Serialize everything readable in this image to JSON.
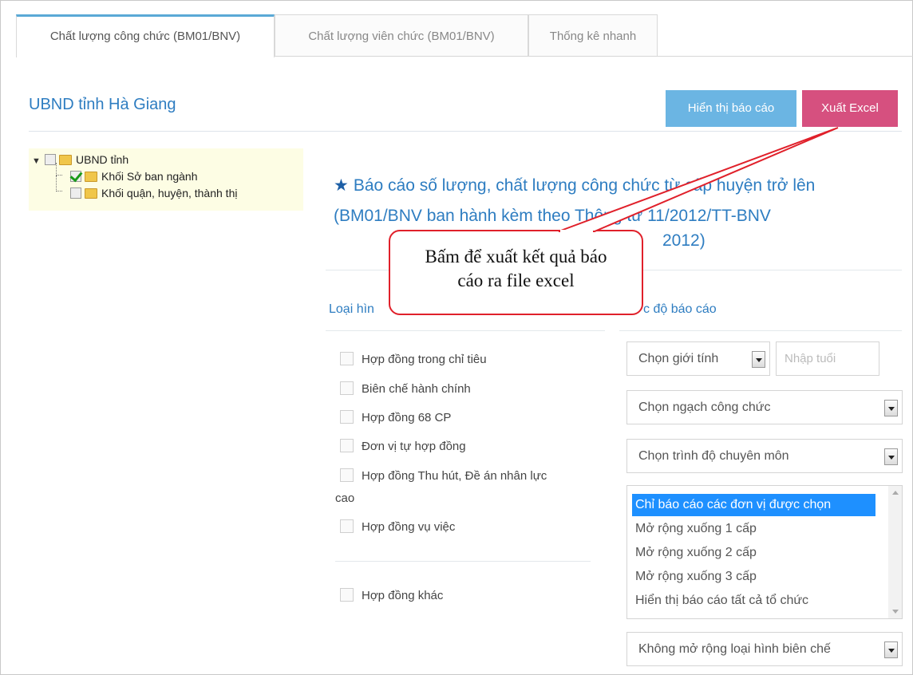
{
  "tabs": [
    {
      "label": "Chất lượng công chức (BM01/BNV)",
      "active": true
    },
    {
      "label": "Chất lượng viên chức (BM01/BNV)",
      "active": false
    },
    {
      "label": "Thống kê nhanh",
      "active": false
    }
  ],
  "header": {
    "org_title": "UBND tỉnh Hà Giang",
    "show_report_label": "Hiển thị báo cáo",
    "export_excel_label": "Xuất Excel"
  },
  "tree": {
    "root": {
      "label": "UBND tỉnh",
      "checked": false
    },
    "children": [
      {
        "label": "Khối Sở ban ngành",
        "checked": true
      },
      {
        "label": "Khối quận, huyện, thành thị",
        "checked": false
      }
    ]
  },
  "report": {
    "star_icon": "star-icon",
    "title": "Báo cáo số lượng, chất lượng công chức từ cấp huyện trở lên (BM01/BNV ban hành kèm theo Thông tư 11/2012/TT-BNV",
    "title_tail": "2012)"
  },
  "sections": {
    "left_label": "Loại hìn",
    "right_label": "c độ báo cáo"
  },
  "employment_types": [
    {
      "label": "Hợp đồng trong chỉ tiêu"
    },
    {
      "label": "Biên chế hành chính"
    },
    {
      "label": "Hợp đồng 68 CP"
    },
    {
      "label": "Đơn vị tự hợp đồng"
    },
    {
      "label": "Hợp đồng Thu hút, Đề án nhân lực"
    },
    {
      "label": "Hợp đồng vụ việc"
    }
  ],
  "employment_types_cont": "cao",
  "other_type": {
    "label": "Hợp đồng khác"
  },
  "filters": {
    "gender_select": "Chọn giới tính",
    "age_placeholder": "Nhập tuổi",
    "rank_select": "Chọn ngạch công chức",
    "qualification_select": "Chọn trình độ chuyên môn",
    "scope_options": [
      "Chỉ báo cáo các đơn vị được chọn",
      "Mở rộng xuống 1 cấp",
      "Mở rộng xuống 2 cấp",
      "Mở rộng xuống 3 cấp",
      "Hiển thị báo cáo tất cả tổ chức"
    ],
    "scope_selected_index": 0,
    "staffing_select": "Không mở rộng loại hình biên chế"
  },
  "callout": {
    "line1": "Bấm để xuất kết quả báo",
    "line2": "cáo ra file excel"
  },
  "colors": {
    "accent_blue": "#2e7dc1",
    "show_button": "#6bb5e3",
    "excel_button": "#d6507f",
    "callout_red": "#e0202a",
    "selected_option": "#1e90ff"
  }
}
